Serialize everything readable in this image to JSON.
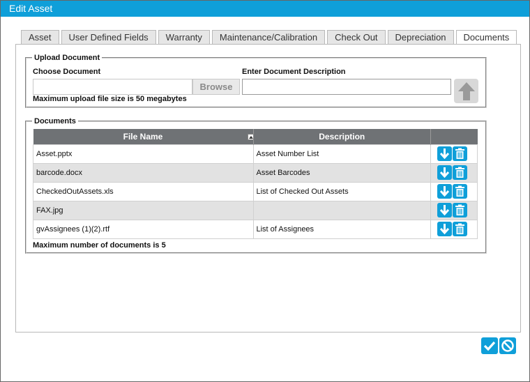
{
  "window": {
    "title": "Edit Asset"
  },
  "tabs": [
    {
      "label": "Asset"
    },
    {
      "label": "User Defined Fields"
    },
    {
      "label": "Warranty"
    },
    {
      "label": "Maintenance/Calibration"
    },
    {
      "label": "Check Out"
    },
    {
      "label": "Depreciation"
    },
    {
      "label": "Documents",
      "active": true
    }
  ],
  "upload": {
    "legend": "Upload Document",
    "choose_label": "Choose Document",
    "file_value": "",
    "browse_label": "Browse",
    "description_label": "Enter Document Description",
    "description_value": "",
    "max_size_note": "Maximum upload file size is 50 megabytes",
    "upload_icon": "arrow-up-icon"
  },
  "documents": {
    "legend": "Documents",
    "columns": {
      "file_name": "File Name",
      "description": "Description",
      "actions": ""
    },
    "rows": [
      {
        "file_name": "Asset.pptx",
        "description": "Asset Number List"
      },
      {
        "file_name": "barcode.docx",
        "description": "Asset Barcodes"
      },
      {
        "file_name": "CheckedOutAssets.xls",
        "description": "List of Checked Out Assets"
      },
      {
        "file_name": "FAX.jpg",
        "description": ""
      },
      {
        "file_name": "gvAssignees (1)(2).rtf",
        "description": "List of Assignees"
      }
    ],
    "max_docs_note": "Maximum number of documents is 5"
  },
  "footer": {
    "save_icon": "checkmark-icon",
    "cancel_icon": "cancel-circle-icon"
  },
  "colors": {
    "accent": "#0f9fd9",
    "header": "#6f7275",
    "alt_row": "#e2e2e2"
  }
}
